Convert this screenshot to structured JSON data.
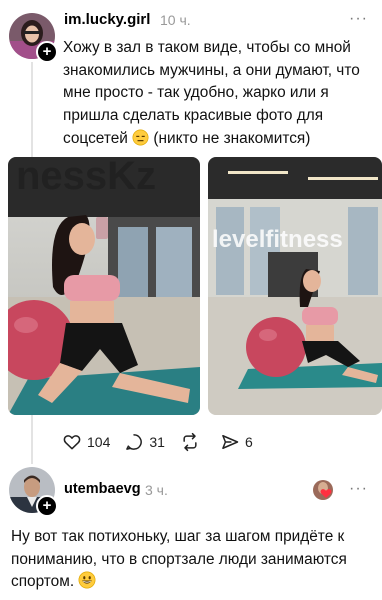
{
  "post": {
    "username": "im.lucky.girl",
    "time": "10 ч.",
    "text": "Хожу в зал в таком виде, чтобы со мной знакомились мужчины, а они думают, что мне просто - так удобно, жарко или я пришла сделать красивые фото для соцсетей",
    "text_tail": "(никто не знакомится)",
    "images": [
      {
        "watermark": "nessKz"
      },
      {
        "watermark": "levelfitness"
      }
    ],
    "likes": "104",
    "comments": "31",
    "shares": "6"
  },
  "reply": {
    "username": "utembaevg",
    "time": "3 ч.",
    "text": "Ну вот так потихоньку, шаг за шагом придёте к пониманию, что в спортзале люди занимаются спортом."
  },
  "more_label": "···",
  "plus_label": "+",
  "colors": {
    "muted": "#999999",
    "ball": "#c8475e",
    "mat": "#2a8a8a"
  }
}
